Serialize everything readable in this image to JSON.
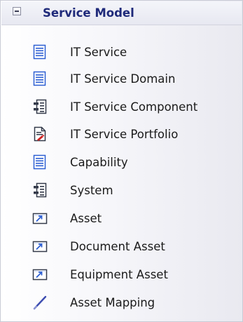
{
  "panel": {
    "title": "Service Model",
    "collapse_glyph": "minus-box-icon"
  },
  "items": [
    {
      "label": "IT Service",
      "icon": "list-document-icon"
    },
    {
      "label": "IT Service Domain",
      "icon": "list-document-icon"
    },
    {
      "label": "IT Service Component",
      "icon": "component-icon"
    },
    {
      "label": "IT Service Portfolio",
      "icon": "portfolio-document-icon"
    },
    {
      "label": "Capability",
      "icon": "list-document-icon"
    },
    {
      "label": "System",
      "icon": "component-icon"
    },
    {
      "label": "Asset",
      "icon": "asset-arrow-icon"
    },
    {
      "label": "Document Asset",
      "icon": "asset-arrow-icon"
    },
    {
      "label": "Equipment Asset",
      "icon": "asset-arrow-icon"
    },
    {
      "label": "Asset Mapping",
      "icon": "diagonal-line-icon"
    }
  ],
  "colors": {
    "header_text": "#1f2a7a",
    "icon_blue": "#2d5fd3",
    "icon_dark": "#343a4a",
    "icon_red": "#d02020"
  }
}
